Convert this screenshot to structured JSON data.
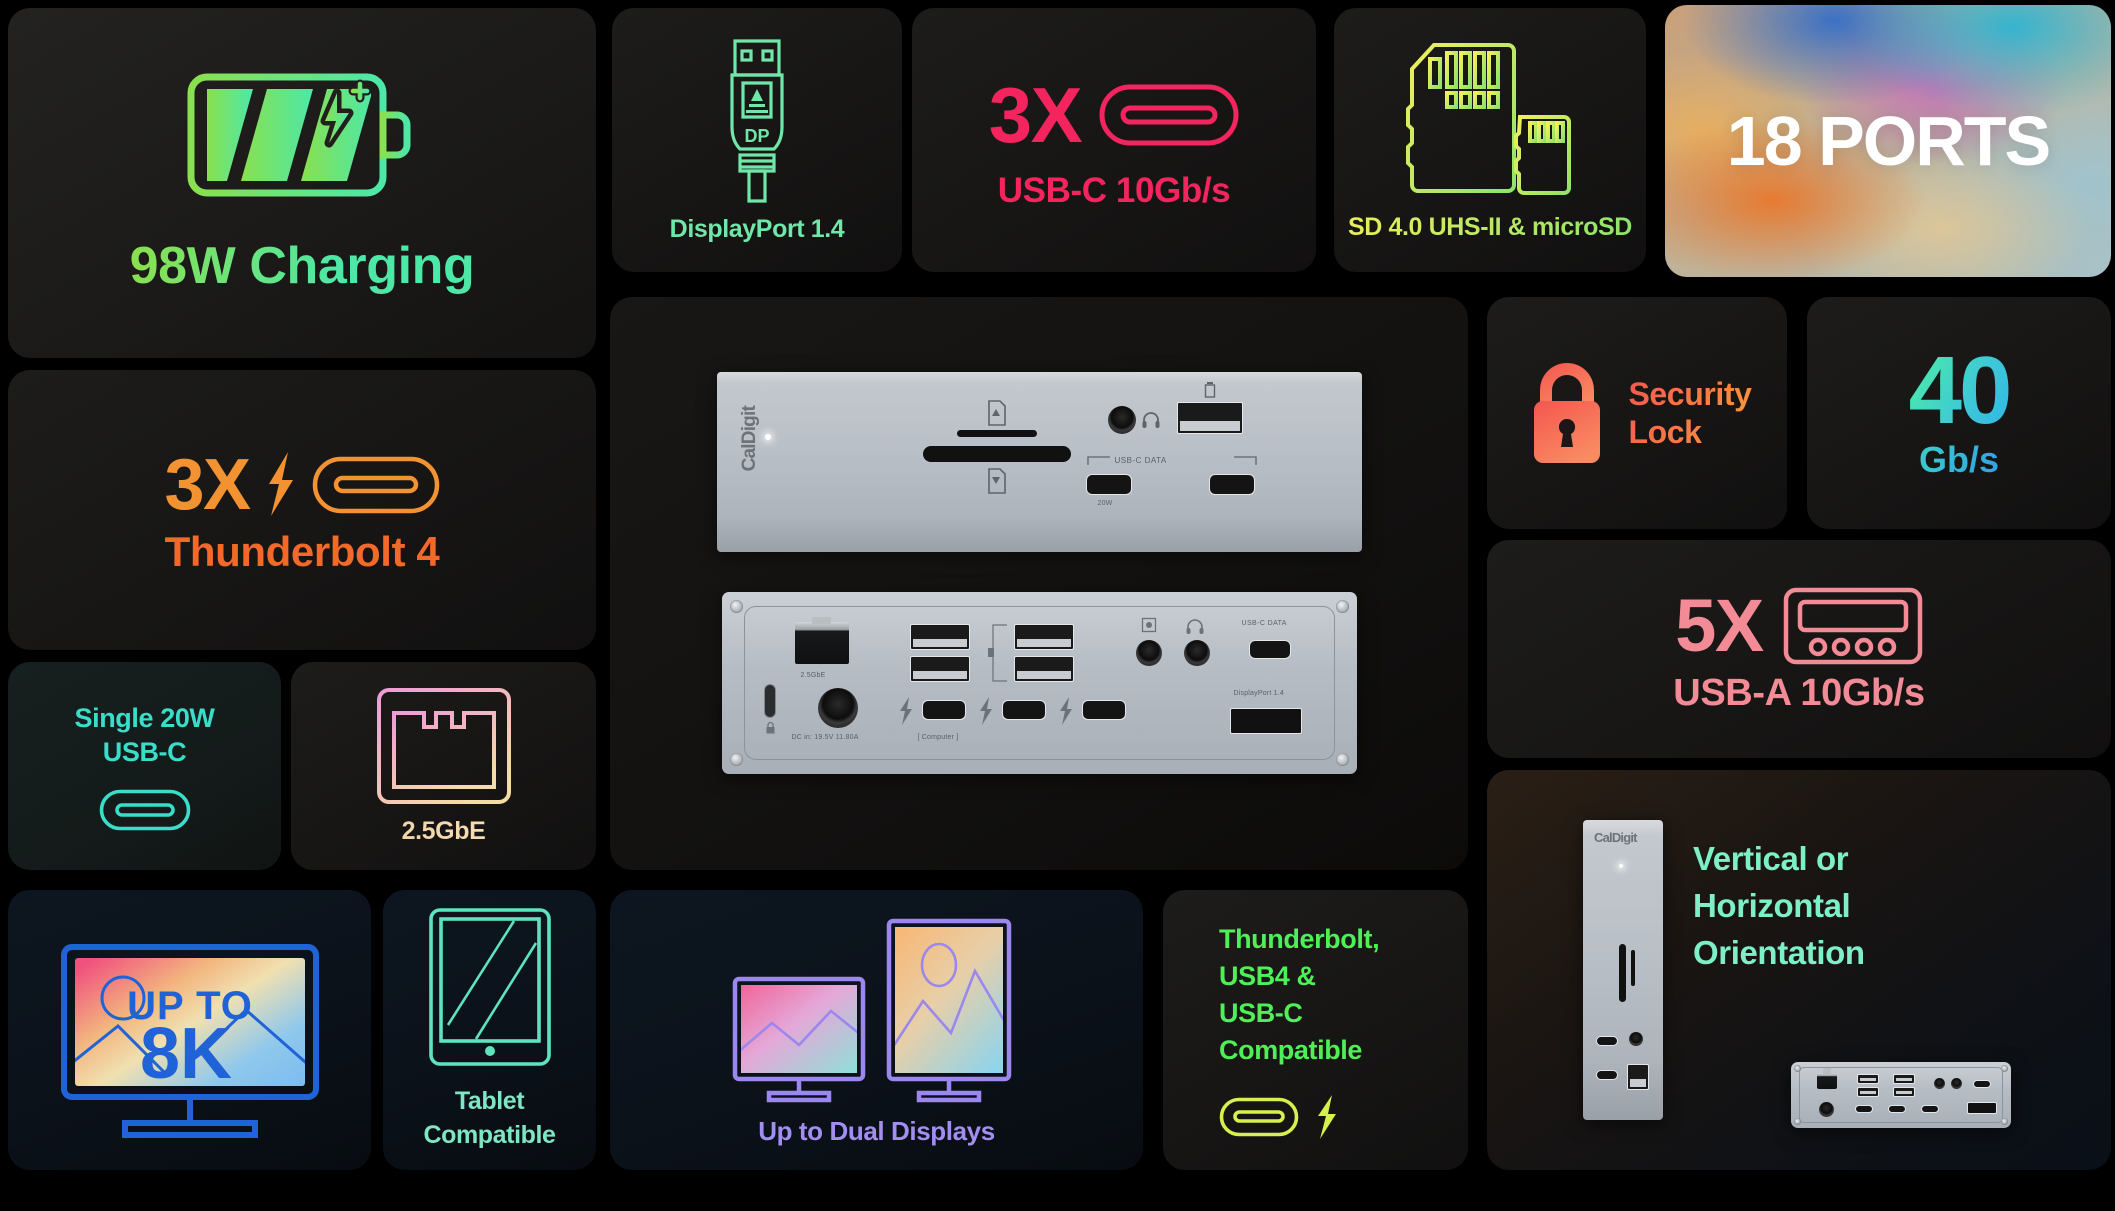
{
  "cards": {
    "charging": {
      "label": "98W Charging",
      "icon": "battery-charging-icon"
    },
    "displayport": {
      "label": "DisplayPort 1.4",
      "icon": "displayport-connector-icon",
      "connector_text": "DP"
    },
    "usbc3x": {
      "count": "3X",
      "label": "USB-C 10Gb/s",
      "icon": "usb-c-port-icon"
    },
    "sd": {
      "label": "SD 4.0 UHS-II & microSD",
      "icon": "sd-card-icon"
    },
    "ports": {
      "label": "18 PORTS"
    },
    "thunderbolt": {
      "count": "3X",
      "label": "Thunderbolt 4",
      "icon": "usb-c-port-icon"
    },
    "lock": {
      "line1": "Security",
      "line2": "Lock",
      "icon": "padlock-icon"
    },
    "speed": {
      "value": "40",
      "unit": "Gb/s"
    },
    "usba": {
      "count": "5X",
      "label": "USB-A 10Gb/s",
      "icon": "usb-a-port-icon"
    },
    "single20w": {
      "line1": "Single 20W",
      "line2": "USB-C",
      "icon": "usb-c-port-icon"
    },
    "ethernet": {
      "label": "2.5GbE",
      "icon": "rj45-ethernet-icon"
    },
    "eightk": {
      "line1": "UP TO",
      "line2": "8K",
      "icon": "monitor-icon"
    },
    "tablet": {
      "line1": "Tablet",
      "line2": "Compatible",
      "icon": "tablet-icon"
    },
    "dual": {
      "label": "Up to Dual Displays",
      "icon": "dual-monitor-icon"
    },
    "compat": {
      "line1": "Thunderbolt,",
      "line2": "USB4 &",
      "line3": "USB-C",
      "line4": "Compatible",
      "icon": "usb-c-port-icon"
    },
    "orientation": {
      "line1": "Vertical or",
      "line2": "Horizontal",
      "line3": "Orientation"
    }
  },
  "product": {
    "brand": "CalDigit",
    "front_labels": {
      "usb_c_data": "USB-C DATA",
      "twenty_w": "20W"
    },
    "rear_labels": {
      "ethernet": "2.5GbE",
      "dc_in": "DC in: 19.5V 11.80A",
      "computer": "[ Computer ]",
      "usb_c_data": "USB-C DATA",
      "displayport": "DisplayPort 1.4"
    }
  },
  "colors": {
    "green": "#5ee89a",
    "dp_green": "#6ee7a8",
    "pink_red": "#f4245e",
    "yellow": "#e8ee5a",
    "orange": "#f29230",
    "orange_deep": "#f2692a",
    "lock_red": "#f4564f",
    "cyan": "#2fb6e8",
    "mint": "#4ef0a0",
    "salmon": "#f28b96",
    "teal": "#39ddc9",
    "peach": "#f3d3a8",
    "blue_8k": "#1f63d6",
    "tablet_mint": "#7fe6c4",
    "purple": "#a28ef0",
    "lime": "#4ef055",
    "orient_mint": "#7df0c8"
  }
}
